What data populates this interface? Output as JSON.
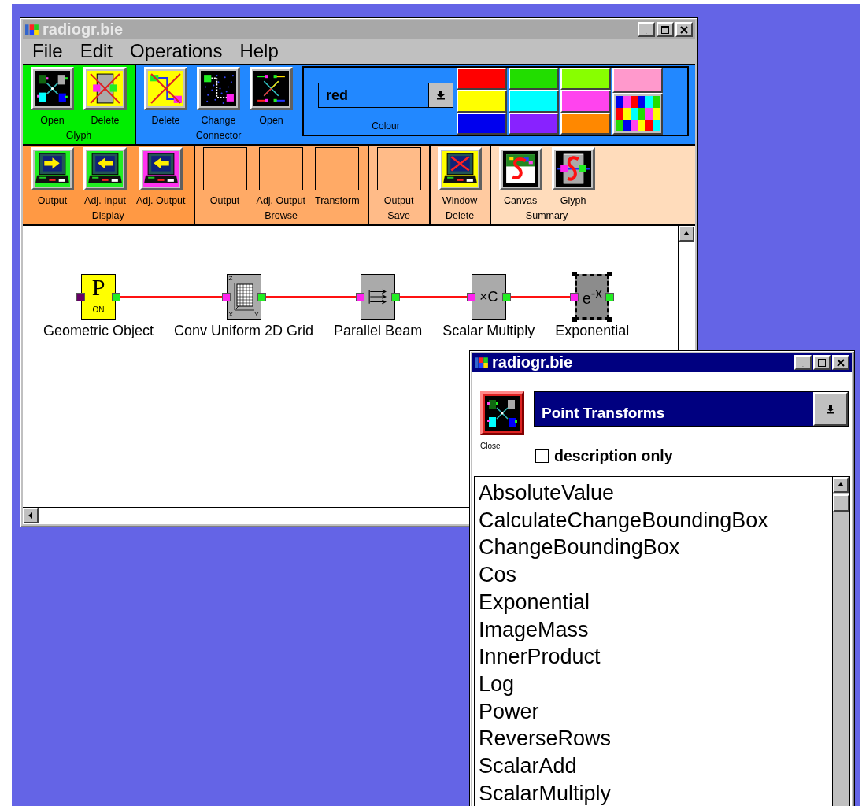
{
  "main_window": {
    "title": "radiogr.bie",
    "menu": [
      "File",
      "Edit",
      "Operations",
      "Help"
    ],
    "toolbar_rows": [
      {
        "groups": [
          {
            "label": "Glyph",
            "color": "#00ee00",
            "buttons": [
              {
                "label": "Open",
                "kind": "glyph-open"
              },
              {
                "label": "Delete",
                "kind": "glyph-delete"
              }
            ]
          },
          {
            "label": "Connector",
            "color": "#2288ff",
            "buttons": [
              {
                "label": "Delete",
                "kind": "connector-delete"
              },
              {
                "label": "Change",
                "kind": "connector-change"
              },
              {
                "label": "Open",
                "kind": "connector-open"
              }
            ],
            "colour_picker": {
              "value": "red",
              "label": "Colour",
              "swatch_columns": [
                [
                  {
                    "kind": "plain",
                    "color": "#ff0000"
                  },
                  {
                    "kind": "plain",
                    "color": "#ffff00"
                  },
                  {
                    "kind": "plain",
                    "color": "#0000ee"
                  }
                ],
                [
                  {
                    "kind": "plain",
                    "color": "#22dd00"
                  },
                  {
                    "kind": "plain",
                    "color": "#00ffff"
                  },
                  {
                    "kind": "plain",
                    "color": "#8822ff"
                  }
                ],
                [
                  {
                    "kind": "plain",
                    "color": "#88ff00"
                  },
                  {
                    "kind": "plain",
                    "color": "#ff44ee"
                  },
                  {
                    "kind": "plain",
                    "color": "#ff8800"
                  }
                ],
                [
                  {
                    "kind": "plain",
                    "color": "#ff99cc"
                  },
                  {
                    "kind": "multi"
                  }
                ]
              ]
            }
          }
        ]
      },
      {
        "groups": [
          {
            "label": "Display",
            "color": "#ff9944",
            "buttons": [
              {
                "label": "Output",
                "kind": "display-output"
              },
              {
                "label": "Adj. Input",
                "kind": "display-adj-input"
              },
              {
                "label": "Adj. Output",
                "kind": "display-adj-output"
              }
            ]
          },
          {
            "label": "Browse",
            "color": "#ffaa66",
            "buttons": [
              {
                "label": "Output",
                "kind": "blank"
              },
              {
                "label": "Adj. Output",
                "kind": "blank"
              },
              {
                "label": "Transform",
                "kind": "blank"
              }
            ]
          },
          {
            "label": "Save",
            "color": "#ffbb88",
            "buttons": [
              {
                "label": "Output",
                "kind": "blank"
              }
            ]
          },
          {
            "label": "Delete",
            "color": "#ffcaa0",
            "buttons": [
              {
                "label": "Window",
                "kind": "window-delete"
              }
            ]
          },
          {
            "label": "Summary",
            "color": "#ffdcbb",
            "buttons": [
              {
                "label": "Canvas",
                "kind": "summary-canvas"
              },
              {
                "label": "Glyph",
                "kind": "summary-glyph"
              }
            ]
          }
        ]
      }
    ],
    "canvas": {
      "nodes": [
        {
          "label": "Geometric Object",
          "kind": "geometric",
          "selected": false,
          "symbol": "P",
          "badge": "ON"
        },
        {
          "label": "Conv Uniform 2D Grid",
          "kind": "grid",
          "selected": false,
          "axes": [
            "Z",
            "X",
            "Y"
          ]
        },
        {
          "label": "Parallel Beam",
          "kind": "beam",
          "selected": false
        },
        {
          "label": "Scalar Multiply",
          "kind": "scalar",
          "selected": false,
          "symbol": "×C"
        },
        {
          "label": "Exponential",
          "kind": "exponential",
          "selected": true,
          "symbol": "e$^{-x}$"
        }
      ]
    }
  },
  "palette_window": {
    "title": "radiogr.bie",
    "close_label": "Close",
    "category": "Point Transforms",
    "checkbox_label": "description only",
    "description_only": false,
    "items": [
      "AbsoluteValue",
      "CalculateChangeBoundingBox",
      "ChangeBoundingBox",
      "Cos",
      "Exponential",
      "ImageMass",
      "InnerProduct",
      "Log",
      "Power",
      "ReverseRows",
      "ScalarAdd",
      "ScalarMultiply"
    ]
  }
}
